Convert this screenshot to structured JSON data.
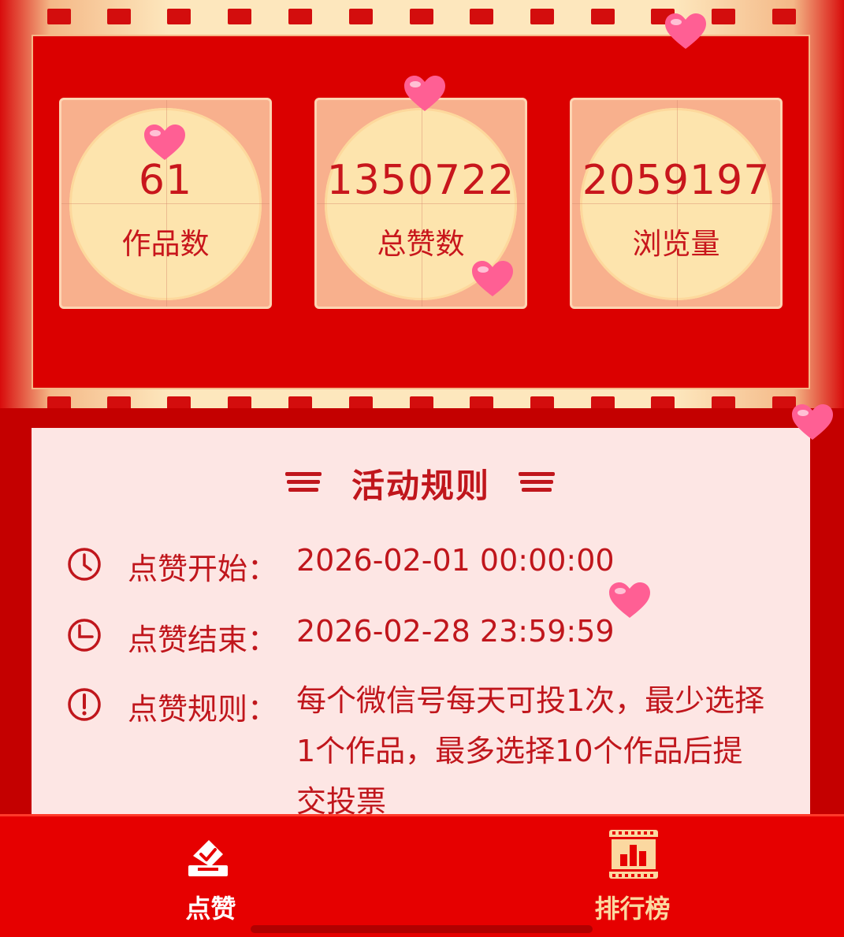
{
  "stats": [
    {
      "value": "61",
      "label": "作品数"
    },
    {
      "value": "1350722",
      "label": "总赞数"
    },
    {
      "value": "2059197",
      "label": "浏览量"
    }
  ],
  "rules": {
    "title": "活动规则",
    "items": [
      {
        "icon": "clock-icon",
        "label": "点赞开始：",
        "value": "2026-02-01 00:00:00"
      },
      {
        "icon": "clock-icon",
        "label": "点赞结束：",
        "value": "2026-02-28 23:59:59"
      },
      {
        "icon": "alert-icon",
        "label": "点赞规则：",
        "value": "每个微信号每天可投1次，最少选择1个作品，最多选择10个作品后提交投票"
      }
    ]
  },
  "nav": {
    "vote": {
      "label": "点赞",
      "icon": "ballot-box-icon",
      "color": "#ffffff"
    },
    "ranking": {
      "label": "排行榜",
      "icon": "bar-chart-film-icon",
      "color": "#fbd8a0"
    }
  },
  "colors": {
    "primary_red": "#e60000",
    "accent_text": "#c8161c",
    "cream": "#fde4ad",
    "heart": "#ff5f94"
  }
}
